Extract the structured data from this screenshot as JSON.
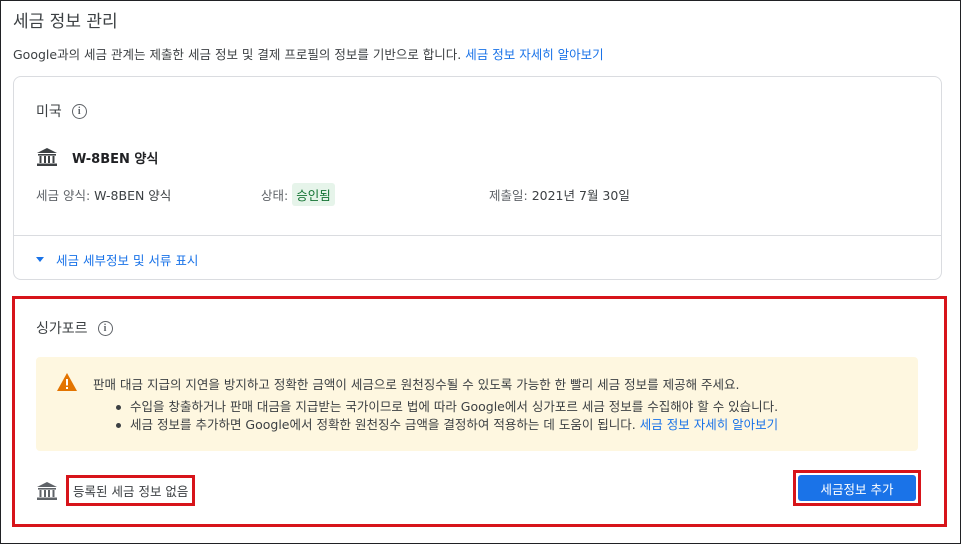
{
  "page": {
    "title": "세금 정보 관리",
    "intro_text": "Google과의 세금 관계는 제출한 세금 정보 및 결제 프로필의 정보를 기반으로 합니다.",
    "intro_link": "세금 정보 자세히 알아보기"
  },
  "us_card": {
    "country": "미국",
    "info_icon": "info-icon",
    "bank_icon": "bank-icon",
    "form_name": "W-8BEN 양식",
    "tax_form_label": "세금 양식:",
    "tax_form_value": "W-8BEN 양식",
    "status_label": "상태:",
    "status_value": "승인됨",
    "submitted_label": "제출일:",
    "submitted_value": "2021년 7월 30일",
    "toggle_details": "세금 세부정보 및 서류 표시"
  },
  "sg_card": {
    "country": "싱가포르",
    "warning": {
      "icon": "warning-icon",
      "title": "판매 대금 지급의 지연을 방지하고 정확한 금액이 세금으로 원천징수될 수 있도록 가능한 한 빨리 세금 정보를 제공해 주세요.",
      "bullet1": "수입을 창출하거나 판매 대금을 지급받는 국가이므로 법에 따라 Google에서 싱가포르 세금 정보를 수집해야 할 수 있습니다.",
      "bullet2_text": "세금 정보를 추가하면 Google에서 정확한 원천징수 금액을 결정하여 적용하는 데 도움이 됩니다.",
      "bullet2_link": "세금 정보 자세히 알아보기"
    },
    "no_info": "등록된 세금 정보 없음",
    "add_button": "세금정보 추가"
  },
  "colors": {
    "accent": "#1a73e8",
    "highlight": "#d7141a",
    "warning_bg": "#fef7e0",
    "approved_bg": "#e6f4ea",
    "approved_text": "#137333"
  }
}
